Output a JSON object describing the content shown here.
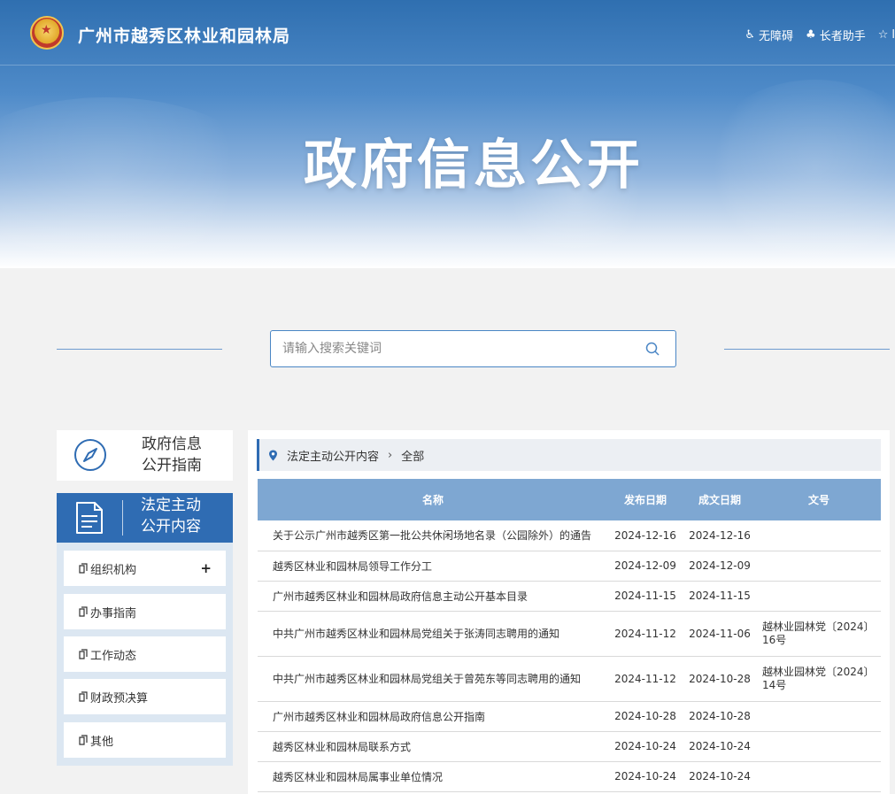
{
  "header": {
    "site_title": "广州市越秀区林业和园林局",
    "tools": [
      {
        "icon": "accessibility-icon",
        "label": "无障碍"
      },
      {
        "icon": "elder-assist-icon",
        "label": "长者助手"
      },
      {
        "icon": "star-icon",
        "label": "l"
      }
    ],
    "hero_title": "政府信息公开"
  },
  "search": {
    "placeholder": "请输入搜索关键词"
  },
  "sidebar": {
    "guide": {
      "line1": "政府信息",
      "line2": "公开指南"
    },
    "legal": {
      "line1": "法定主动",
      "line2": "公开内容"
    },
    "items": [
      {
        "label": "组织机构",
        "expandable": "+"
      },
      {
        "label": "办事指南"
      },
      {
        "label": "工作动态"
      },
      {
        "label": "财政预决算"
      },
      {
        "label": "其他"
      }
    ]
  },
  "breadcrumb": {
    "level1": "法定主动公开内容",
    "level2": "全部"
  },
  "table": {
    "headers": [
      "名称",
      "发布日期",
      "成文日期",
      "文号"
    ],
    "rows": [
      {
        "name": "关于公示广州市越秀区第一批公共休闲场地名录（公园除外）的通告",
        "publish": "2024-12-16",
        "written": "2024-12-16",
        "doc_no": ""
      },
      {
        "name": "越秀区林业和园林局领导工作分工",
        "publish": "2024-12-09",
        "written": "2024-12-09",
        "doc_no": ""
      },
      {
        "name": "广州市越秀区林业和园林局政府信息主动公开基本目录",
        "publish": "2024-11-15",
        "written": "2024-11-15",
        "doc_no": ""
      },
      {
        "name": "中共广州市越秀区林业和园林局党组关于张涛同志聘用的通知",
        "publish": "2024-11-12",
        "written": "2024-11-06",
        "doc_no": "越林业园林党〔2024〕16号"
      },
      {
        "name": "中共广州市越秀区林业和园林局党组关于曾苑东等同志聘用的通知",
        "publish": "2024-11-12",
        "written": "2024-10-28",
        "doc_no": "越林业园林党〔2024〕14号"
      },
      {
        "name": "广州市越秀区林业和园林局政府信息公开指南",
        "publish": "2024-10-28",
        "written": "2024-10-28",
        "doc_no": ""
      },
      {
        "name": "越秀区林业和园林局联系方式",
        "publish": "2024-10-24",
        "written": "2024-10-24",
        "doc_no": ""
      },
      {
        "name": "越秀区林业和园林局属事业单位情况",
        "publish": "2024-10-24",
        "written": "2024-10-24",
        "doc_no": ""
      }
    ]
  },
  "colors": {
    "primary_blue": "#2f6cb3",
    "table_header": "#7ea7d2",
    "side_bg": "#dce7f2"
  }
}
